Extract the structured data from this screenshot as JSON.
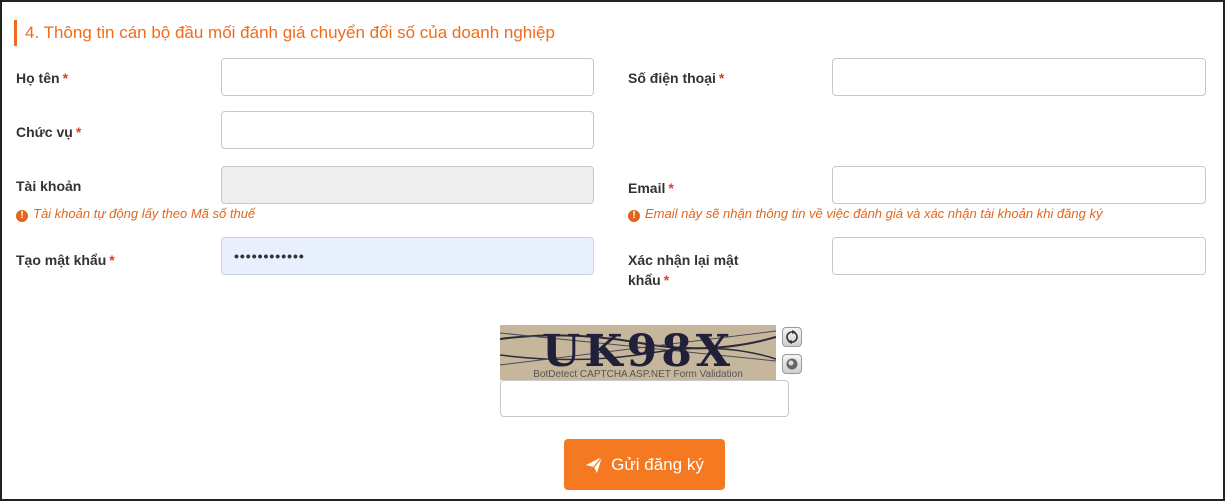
{
  "section": {
    "title": "4. Thông tin cán bộ đầu mối đánh giá chuyển đổi số của doanh nghiệp"
  },
  "required_mark": "*",
  "form": {
    "full_name": {
      "label": "Họ tên",
      "value": ""
    },
    "phone": {
      "label": "Số điện thoại",
      "value": ""
    },
    "position": {
      "label": "Chức vụ",
      "value": ""
    },
    "account": {
      "label": "Tài khoản",
      "value": "",
      "hint": "Tài khoản tự động lấy theo Mã số thuế"
    },
    "email": {
      "label": "Email",
      "value": "",
      "hint": "Email này sẽ nhận thông tin về việc đánh giá và xác nhận tài khoản khi đăng ký"
    },
    "password": {
      "label": "Tạo mật khẩu",
      "value": "••••••••••••"
    },
    "confirm_password": {
      "label_line1": "Xác nhận lại mật",
      "label_line2": "khẩu",
      "value": ""
    }
  },
  "captcha": {
    "code": "UK98X",
    "caption": "BotDetect CAPTCHA ASP.NET Form Validation",
    "input_value": ""
  },
  "submit": {
    "label": "Gửi đăng ký"
  },
  "colors": {
    "accent": "#f26b1d",
    "button": "#f47920",
    "required": "#e03b2d"
  }
}
